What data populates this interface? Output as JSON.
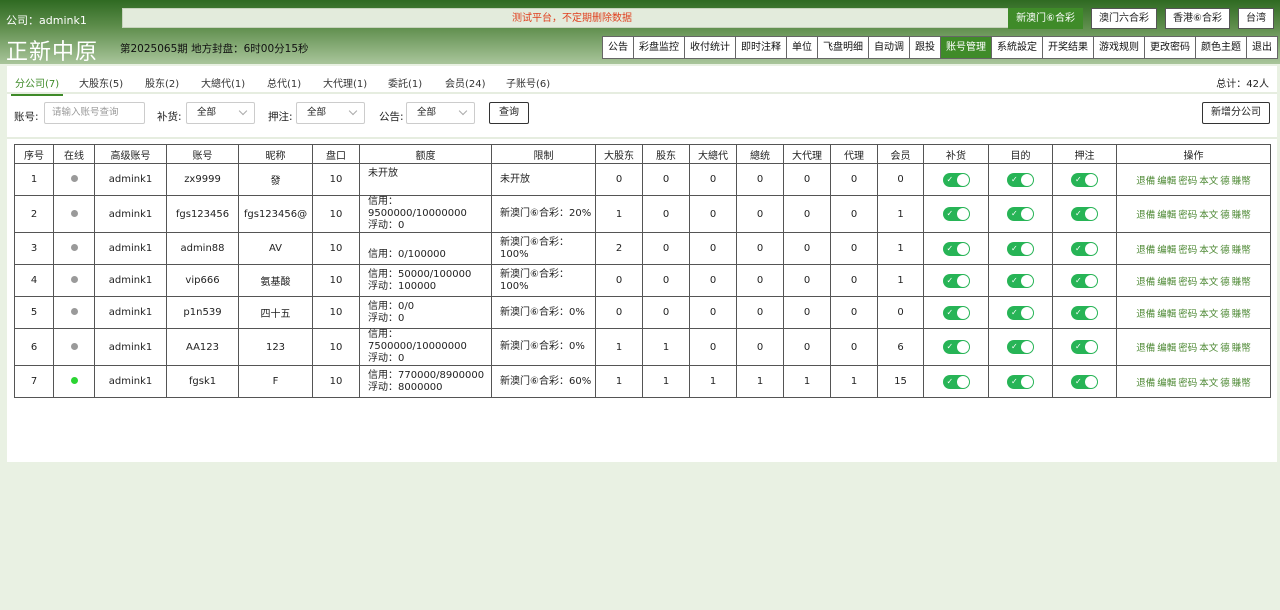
{
  "header": {
    "company": "公司：admink1",
    "notice": "测试平台，不定期删除数据",
    "brand": "正新中原",
    "period": "第2025065期  地方封盘：6时00分15秒",
    "lottery_buttons": [
      "新澳门⑥合彩",
      "澳门六合彩",
      "香港⑥合彩",
      "台湾"
    ],
    "nav": [
      "公告",
      "彩盘监控",
      "收付统计",
      "即时注释",
      "单位",
      "飞盘明细",
      "自动调",
      "跟投",
      "账号管理",
      "系統設定",
      "开奖结果",
      "游戏规则",
      "更改密码",
      "颜色主题",
      "退出"
    ]
  },
  "tabs": [
    "分公司(7)",
    "大股东(5)",
    "股东(2)",
    "大總代(1)",
    "总代(1)",
    "大代理(1)",
    "委託(1)",
    "会员(24)",
    "子账号(6)"
  ],
  "total": "总计：42人",
  "filters": {
    "account_label": "账号:",
    "account_placeholder": "请输入账号查询",
    "supplement_label": "补货:",
    "supplement_value": "全部",
    "stake_label": "押注:",
    "stake_value": "全部",
    "notice_label": "公告:",
    "notice_value": "全部",
    "search_btn": "查询",
    "add_btn": "新增分公司"
  },
  "table": {
    "headers": [
      "序号",
      "在线",
      "高级账号",
      "账号",
      "昵称",
      "盘口",
      "额度",
      "限制",
      "大股东",
      "股东",
      "大總代",
      "總统",
      "大代理",
      "代理",
      "会员",
      "补货",
      "目的",
      "押注",
      "操作"
    ],
    "ops": [
      "退備",
      "编輯",
      "密码",
      "本文",
      "德",
      "賺幣"
    ],
    "rows": [
      {
        "no": "1",
        "online": false,
        "parent": "admink1",
        "account": "zx9999",
        "nick": "發",
        "pan": "10",
        "quota1": "未开放",
        "quota2": "",
        "limit": "未开放",
        "c1": "0",
        "c2": "0",
        "c3": "0",
        "c4": "0",
        "c5": "0",
        "c6": "0",
        "c7": "0"
      },
      {
        "no": "2",
        "online": false,
        "parent": "admink1",
        "account": "fgs123456",
        "nick": "fgs123456@",
        "pan": "10",
        "quota1": "信用：9500000/10000000",
        "quota2": "浮动：0",
        "limit": "新澳门⑥合彩：20%",
        "c1": "1",
        "c2": "0",
        "c3": "0",
        "c4": "0",
        "c5": "0",
        "c6": "0",
        "c7": "1"
      },
      {
        "no": "3",
        "online": false,
        "parent": "admink1",
        "account": "admin88",
        "nick": "AV",
        "pan": "10",
        "quota1": "",
        "quota2": "信用：0/100000",
        "limit": "新澳门⑥合彩：100%",
        "c1": "2",
        "c2": "0",
        "c3": "0",
        "c4": "0",
        "c5": "0",
        "c6": "0",
        "c7": "1"
      },
      {
        "no": "4",
        "online": false,
        "parent": "admink1",
        "account": "vip666",
        "nick": "氨基酸",
        "pan": "10",
        "quota1": "信用：50000/100000",
        "quota2": "浮动：100000",
        "limit": "新澳门⑥合彩：100%",
        "c1": "0",
        "c2": "0",
        "c3": "0",
        "c4": "0",
        "c5": "0",
        "c6": "0",
        "c7": "1"
      },
      {
        "no": "5",
        "online": false,
        "parent": "admink1",
        "account": "p1n539",
        "nick": "四十五",
        "pan": "10",
        "quota1": "信用：0/0",
        "quota2": "浮动：0",
        "limit": "新澳门⑥合彩：0%",
        "c1": "0",
        "c2": "0",
        "c3": "0",
        "c4": "0",
        "c5": "0",
        "c6": "0",
        "c7": "0"
      },
      {
        "no": "6",
        "online": false,
        "parent": "admink1",
        "account": "AA123",
        "nick": "123",
        "pan": "10",
        "quota1": "信用：7500000/10000000",
        "quota2": "浮动：0",
        "limit": "新澳门⑥合彩：0%",
        "c1": "1",
        "c2": "1",
        "c3": "0",
        "c4": "0",
        "c5": "0",
        "c6": "0",
        "c7": "6"
      },
      {
        "no": "7",
        "online": true,
        "parent": "admink1",
        "account": "fgsk1",
        "nick": "F",
        "pan": "10",
        "quota1": "信用：770000/8900000",
        "quota2": "浮动：8000000",
        "limit": "新澳门⑥合彩：60%",
        "c1": "1",
        "c2": "1",
        "c3": "1",
        "c4": "1",
        "c5": "1",
        "c6": "1",
        "c7": "15"
      }
    ]
  }
}
